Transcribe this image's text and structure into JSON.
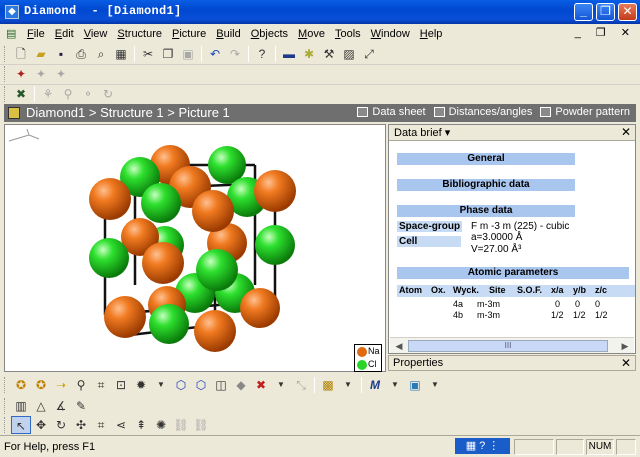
{
  "window": {
    "title": "Diamond  - [Diamond1]",
    "app_icon": "diamond-app-icon",
    "controls": [
      "_",
      "❐",
      "✕"
    ]
  },
  "menu": {
    "items": [
      "File",
      "Edit",
      "View",
      "Structure",
      "Picture",
      "Build",
      "Objects",
      "Move",
      "Tools",
      "Window",
      "Help"
    ],
    "mdi_controls": "_ ❐ ✕"
  },
  "toolbars": {
    "standard": [
      "new",
      "open",
      "save",
      "print",
      "print-preview",
      "export",
      "cut",
      "copy",
      "paste",
      "undo",
      "redo",
      "help-pointer",
      "tb1",
      "tb2",
      "tb3",
      "tb4",
      "tb5"
    ],
    "row2": [
      "r2a",
      "r2b",
      "r2c"
    ],
    "row3": [
      "r3a",
      "r3b",
      "r3c",
      "r3d",
      "r3e"
    ]
  },
  "breadcrumb": {
    "path": "Diamond1 > Structure 1 > Picture 1"
  },
  "view_tabs": [
    {
      "label": "Data sheet",
      "icon": "data-sheet-icon"
    },
    {
      "label": "Distances/angles",
      "icon": "distances-icon"
    },
    {
      "label": "Powder pattern",
      "icon": "powder-pattern-icon"
    }
  ],
  "legend": {
    "items": [
      {
        "label": "Na",
        "color": "#e06a10"
      },
      {
        "label": "Cl",
        "color": "#28d428"
      }
    ]
  },
  "data_panel": {
    "title": "Data brief",
    "sections": {
      "general": "General",
      "bibliographic": "Bibliographic data",
      "phase": "Phase data",
      "atomic": "Atomic parameters"
    },
    "space_group_label": "Space-group",
    "space_group_value": "F m -3 m (225) - cubic",
    "cell_label": "Cell",
    "cell_a": "a=3.0000 Å",
    "cell_v": "V=27.00 Å³",
    "atom_headers": [
      "Atom",
      "Ox.",
      "Wyck.",
      "Site",
      "S.O.F.",
      "x/a",
      "y/b",
      "z/c"
    ],
    "atom_rows": [
      {
        "wyck": "4a",
        "site": "m-3m",
        "x": "0",
        "y": "0",
        "z": "0"
      },
      {
        "wyck": "4b",
        "site": "m-3m",
        "x": "1/2",
        "y": "1/2",
        "z": "1/2"
      }
    ],
    "scroll_mid": "III"
  },
  "properties": {
    "title": "Properties"
  },
  "statusbar": {
    "help": "For Help, press F1",
    "num": "NUM"
  },
  "colors": {
    "na": "#e06a10",
    "cl": "#28d428",
    "section_bar": "#a9c6ef",
    "title_bar": "#0a5ee4"
  }
}
